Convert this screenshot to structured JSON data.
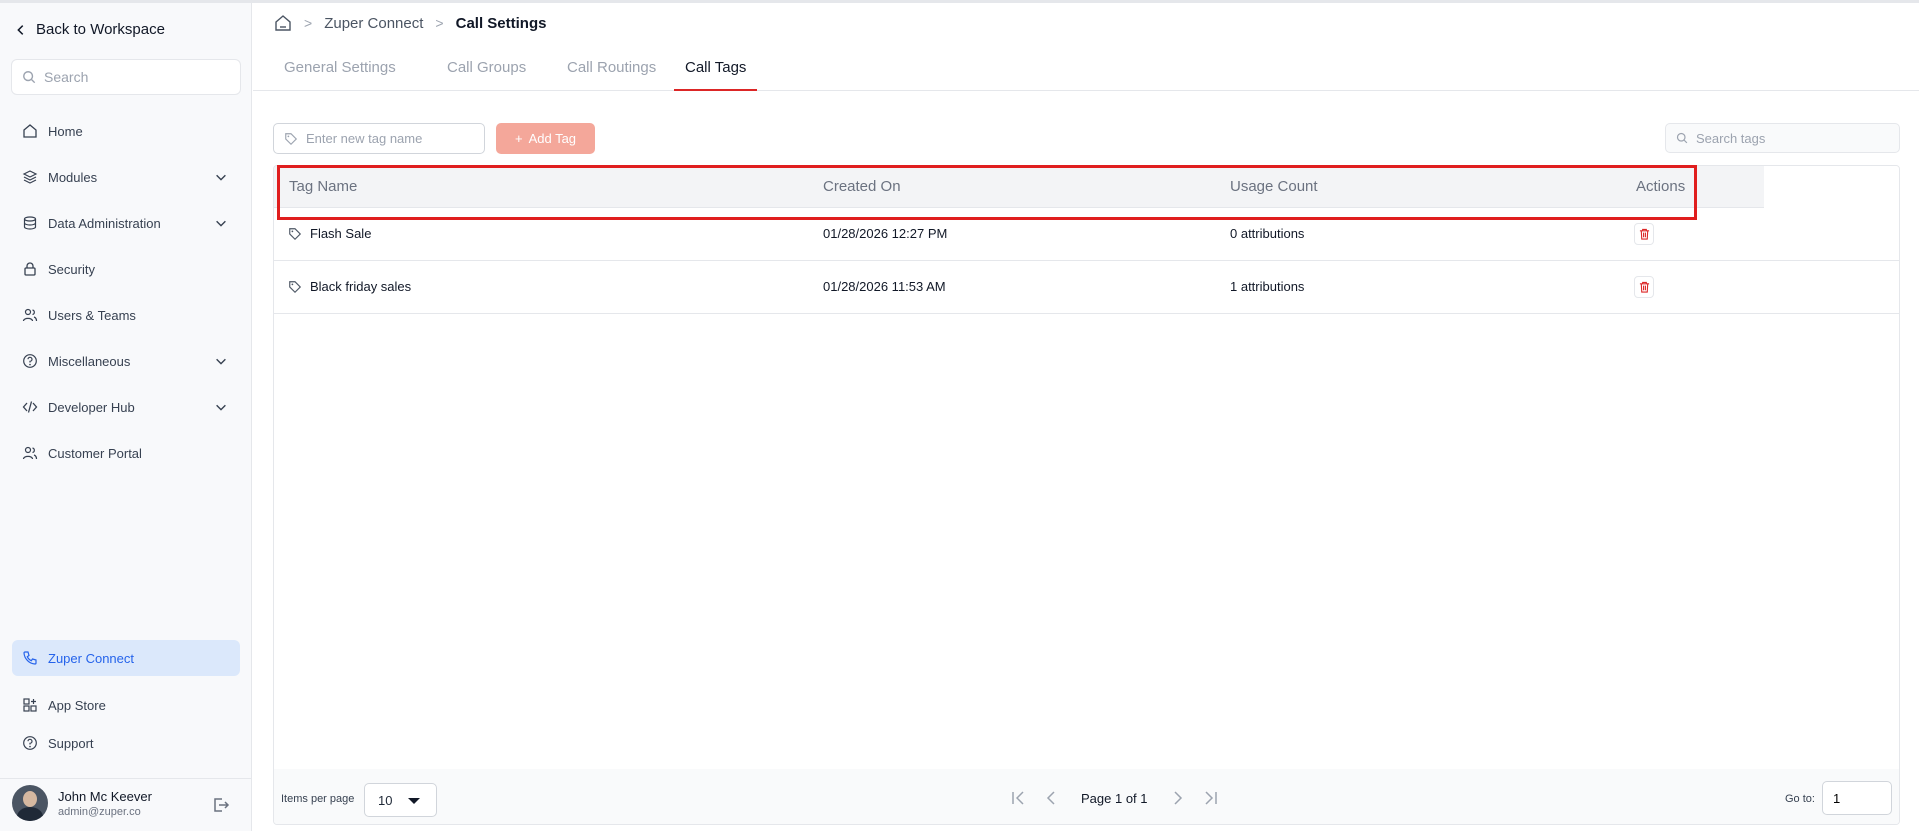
{
  "sidebar": {
    "back_label": "Back to Workspace",
    "search_placeholder": "Search",
    "items": [
      {
        "label": "Home"
      },
      {
        "label": "Modules"
      },
      {
        "label": "Data Administration"
      },
      {
        "label": "Security"
      },
      {
        "label": "Users & Teams"
      },
      {
        "label": "Miscellaneous"
      },
      {
        "label": "Developer Hub"
      },
      {
        "label": "Customer Portal"
      }
    ],
    "bottom_items": [
      {
        "label": "Zuper Connect"
      },
      {
        "label": "App Store"
      },
      {
        "label": "Support"
      }
    ],
    "user": {
      "name": "John Mc Keever",
      "email": "admin@zuper.co"
    }
  },
  "breadcrumb": {
    "items": [
      "Zuper Connect",
      "Call Settings"
    ]
  },
  "tabs": [
    "General Settings",
    "Call Groups",
    "Call Routings",
    "Call Tags"
  ],
  "toolbar": {
    "tag_placeholder": "Enter new tag name",
    "add_label": "Add Tag",
    "search_placeholder": "Search tags"
  },
  "table": {
    "columns": [
      "Tag Name",
      "Created On",
      "Usage Count",
      "Actions"
    ],
    "rows": [
      {
        "name": "Flash Sale",
        "created": "01/28/2026 12:27 PM",
        "usage": "0 attributions"
      },
      {
        "name": "Black friday sales",
        "created": "01/28/2026 11:53 AM",
        "usage": "1 attributions"
      }
    ]
  },
  "pagination": {
    "items_per_page_label": "Items per page",
    "items_per_page": "10",
    "page_text": "Page 1 of 1",
    "goto_label": "Go to:",
    "goto_value": "1"
  },
  "colors": {
    "accent": "#dc2626",
    "active_nav_bg": "#dbe8fb",
    "add_button": "#f4a79a",
    "highlight": "#e01e1e"
  }
}
